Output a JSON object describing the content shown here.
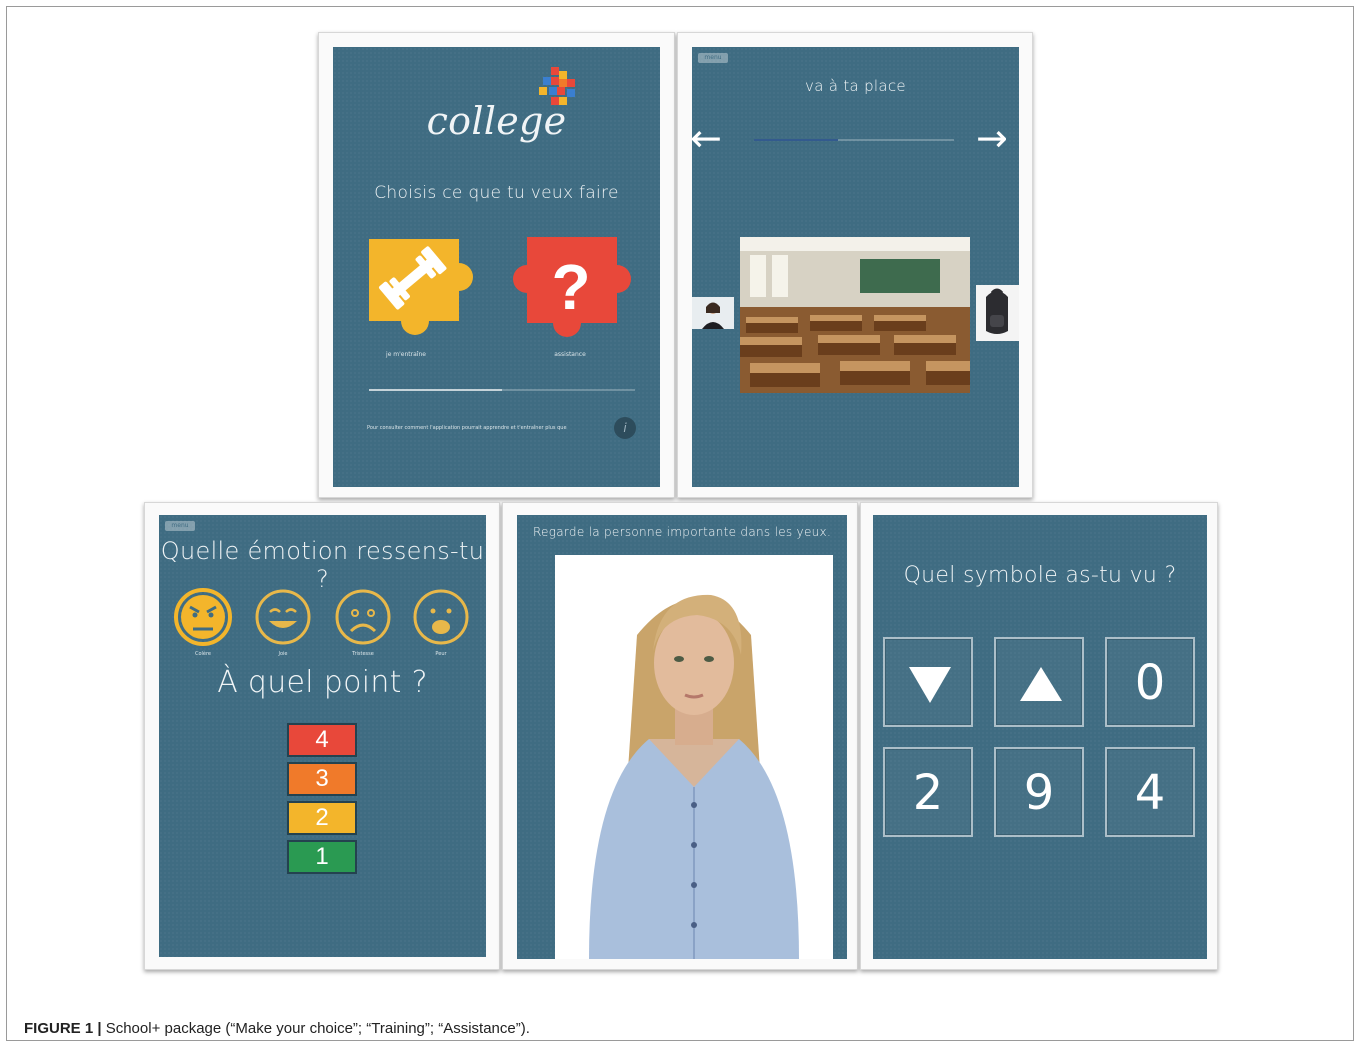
{
  "caption": {
    "label": "FIGURE 1 |",
    "text": " School+ package (“Make your choice”; “Training”; “Assistance”)."
  },
  "screen_choice": {
    "logo_text": "college",
    "prompt": "Choisis ce que tu veux faire",
    "options": [
      {
        "label": "je m'entraîne",
        "icon": "dumbbell-icon",
        "color": "#f3b52b"
      },
      {
        "label": "assistance",
        "icon": "question-mark-icon",
        "color": "#e8483a"
      }
    ],
    "footer_text": "Pour consulter comment l'application pourrait apprendre et t'entraîner plus que",
    "info_icon": "i"
  },
  "screen_training": {
    "tag": "menu",
    "title": "va à ta place",
    "left_arrow": "←",
    "right_arrow": "→"
  },
  "screen_emotion": {
    "tag": "menu",
    "title": "Quelle émotion ressens-tu ?",
    "emotions": [
      {
        "label": "Colère",
        "icon": "angry-face-icon"
      },
      {
        "label": "Joie",
        "icon": "happy-face-icon"
      },
      {
        "label": "Tristesse",
        "icon": "sad-face-icon"
      },
      {
        "label": "Peur",
        "icon": "scared-face-icon"
      }
    ],
    "subtitle": "À quel point ?",
    "levels": [
      {
        "value": "4",
        "color": "#e8483a"
      },
      {
        "value": "3",
        "color": "#f07a2a"
      },
      {
        "value": "2",
        "color": "#f3b52b"
      },
      {
        "value": "1",
        "color": "#2a9a52"
      }
    ]
  },
  "screen_gaze": {
    "title": "Regarde la personne importante dans les yeux."
  },
  "screen_symbol": {
    "title": "Quel symbole as-tu vu ?",
    "tiles": [
      "▼",
      "▲",
      "0",
      "2",
      "9",
      "4"
    ]
  }
}
